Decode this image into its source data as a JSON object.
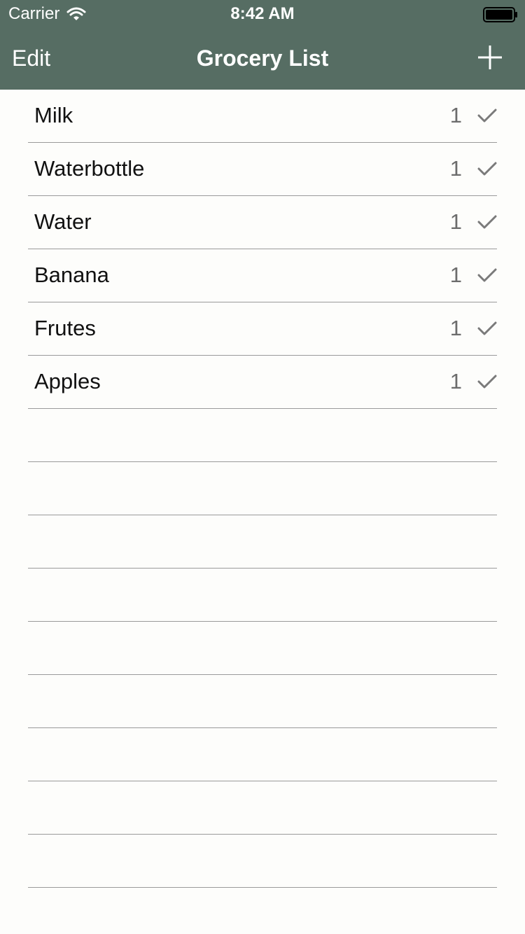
{
  "status_bar": {
    "carrier": "Carrier",
    "time": "8:42 AM"
  },
  "nav": {
    "edit_label": "Edit",
    "title": "Grocery List",
    "add_icon": "plus-icon"
  },
  "colors": {
    "nav_background": "#566d63",
    "nav_text": "#ffffff",
    "separator": "#9a9a9a",
    "checkmark": "#7a7a7a"
  },
  "items": [
    {
      "name": "Milk",
      "quantity": "1",
      "checked": true
    },
    {
      "name": "Waterbottle",
      "quantity": "1",
      "checked": true
    },
    {
      "name": "Water",
      "quantity": "1",
      "checked": true
    },
    {
      "name": "Banana",
      "quantity": "1",
      "checked": true
    },
    {
      "name": "Frutes",
      "quantity": "1",
      "checked": true
    },
    {
      "name": "Apples",
      "quantity": "1",
      "checked": true
    }
  ]
}
